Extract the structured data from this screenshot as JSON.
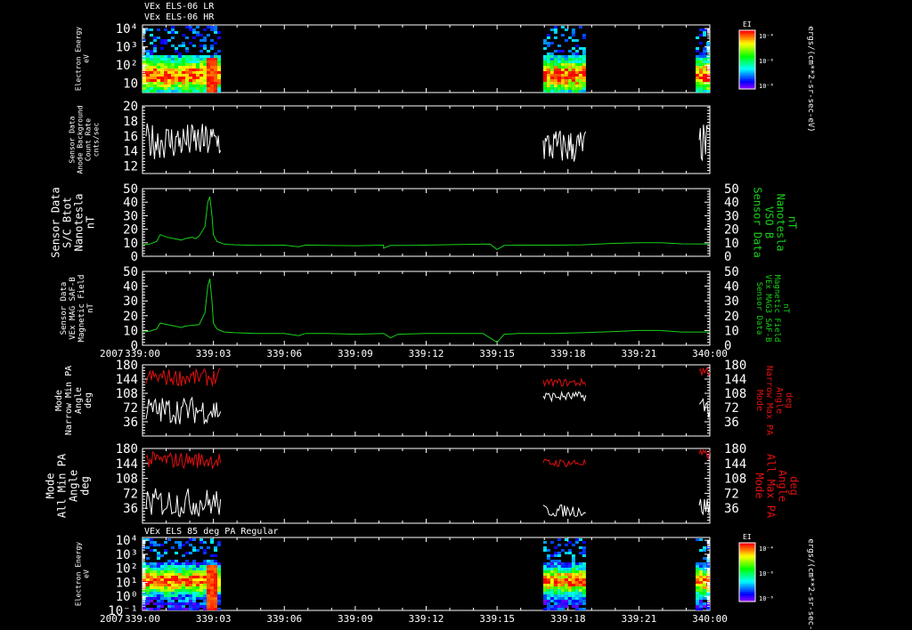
{
  "header": {
    "line1": "VEx ELS-06 LR",
    "line2": "VEx ELS-06 HR",
    "bottom_title": "VEx ELS 85 deg PA Regular",
    "year_label": "2007"
  },
  "colorbar": {
    "label": "EI",
    "ticks": [
      "10⁻⁴",
      "10⁻⁶",
      "10⁻⁸"
    ],
    "unit_label": "ergs/(cm**2-sr-sec-eV)"
  },
  "time_axis": {
    "ticks": [
      "339:00",
      "339:03",
      "339:06",
      "339:09",
      "339:12",
      "339:15",
      "339:18",
      "339:21",
      "340:00"
    ]
  },
  "colors": {
    "green": "#18d018",
    "red": "#e01010",
    "white": "#ffffff"
  },
  "chart_data": [
    {
      "type": "heatmap",
      "name": "electron-energy-top",
      "ylabel": [
        "Electron Energy",
        "eV"
      ],
      "yticks": [
        "10⁴",
        "10³",
        "10²",
        "10"
      ],
      "ylog": true,
      "ylim_exp": [
        0.5,
        4.2
      ],
      "data_intervals_hr": [
        [
          0.0,
          1.1
        ],
        [
          5.65,
          6.25
        ],
        [
          7.8,
          8.0
        ]
      ]
    },
    {
      "type": "line",
      "name": "anode-background",
      "ylabel": [
        "Sensor Data",
        "Anode Background",
        "Count Rate",
        "cnts/sec"
      ],
      "ylim": [
        11,
        20
      ],
      "yticks": [
        12,
        14,
        16,
        18,
        20
      ],
      "series": [
        {
          "color": "white",
          "segments": [
            {
              "t0": 0.05,
              "t1": 1.1,
              "mean": 15.3,
              "amp": 2.4,
              "n": 70
            },
            {
              "t0": 5.65,
              "t1": 6.25,
              "mean": 14.6,
              "amp": 2.4,
              "n": 40
            },
            {
              "t0": 7.85,
              "t1": 8.0,
              "mean": 15.0,
              "amp": 2.6,
              "n": 10
            }
          ]
        }
      ]
    },
    {
      "type": "line",
      "name": "btot",
      "ylabel": [
        "Sensor Data",
        "S/C Btot",
        "Nanotesla",
        "nT"
      ],
      "ylabel_right": [
        "Sensor Data",
        "VSO B",
        "Nanotesla",
        "nT"
      ],
      "ylim": [
        0,
        50
      ],
      "yticks": [
        0,
        10,
        20,
        30,
        40,
        50
      ],
      "series": [
        {
          "color": "green",
          "points": [
            [
              0.0,
              8.5
            ],
            [
              0.1,
              9
            ],
            [
              0.2,
              11
            ],
            [
              0.25,
              16
            ],
            [
              0.35,
              14
            ],
            [
              0.45,
              13
            ],
            [
              0.55,
              12
            ],
            [
              0.6,
              13
            ],
            [
              0.7,
              14
            ],
            [
              0.75,
              13
            ],
            [
              0.8,
              15
            ],
            [
              0.88,
              22
            ],
            [
              0.92,
              40
            ],
            [
              0.95,
              44
            ],
            [
              0.98,
              30
            ],
            [
              1.0,
              16
            ],
            [
              1.05,
              11
            ],
            [
              1.15,
              9
            ],
            [
              1.3,
              8.5
            ],
            [
              1.6,
              8
            ],
            [
              2.0,
              8.2
            ],
            [
              2.2,
              7
            ],
            [
              2.3,
              8.3
            ],
            [
              2.6,
              8
            ],
            [
              3.0,
              7.8
            ],
            [
              3.4,
              8.2
            ],
            [
              3.4,
              6
            ],
            [
              3.5,
              8
            ],
            [
              3.8,
              8
            ],
            [
              4.2,
              8.5
            ],
            [
              4.9,
              9
            ],
            [
              5.0,
              5
            ],
            [
              5.1,
              8
            ],
            [
              5.3,
              8.2
            ],
            [
              5.8,
              8.2
            ],
            [
              6.2,
              8.5
            ],
            [
              6.6,
              9.5
            ],
            [
              7.0,
              10
            ],
            [
              7.3,
              10
            ],
            [
              7.6,
              9.2
            ],
            [
              8.0,
              9
            ]
          ]
        }
      ]
    },
    {
      "type": "line",
      "name": "saf-b",
      "ylabel": [
        "Sensor Data",
        "VEx MAG SAF-B",
        "Magnetic Field",
        "nT"
      ],
      "ylabel_right": [
        "Sensor Data",
        "VEx MAG3 SAF-B",
        "Magnetic Field",
        "nT"
      ],
      "ylim": [
        0,
        50
      ],
      "yticks": [
        0,
        10,
        20,
        30,
        40,
        50
      ],
      "series": [
        {
          "color": "green",
          "points": [
            [
              0.0,
              9
            ],
            [
              0.1,
              9.5
            ],
            [
              0.2,
              11
            ],
            [
              0.25,
              15
            ],
            [
              0.35,
              14
            ],
            [
              0.45,
              13
            ],
            [
              0.55,
              12
            ],
            [
              0.6,
              13
            ],
            [
              0.7,
              13.5
            ],
            [
              0.8,
              14
            ],
            [
              0.88,
              22
            ],
            [
              0.92,
              40
            ],
            [
              0.95,
              45
            ],
            [
              0.98,
              30
            ],
            [
              1.0,
              15
            ],
            [
              1.05,
              11
            ],
            [
              1.15,
              9
            ],
            [
              1.3,
              8.5
            ],
            [
              1.6,
              8
            ],
            [
              2.0,
              8
            ],
            [
              2.2,
              6.5
            ],
            [
              2.3,
              8
            ],
            [
              2.6,
              8
            ],
            [
              3.0,
              7.5
            ],
            [
              3.4,
              8
            ],
            [
              3.5,
              5
            ],
            [
              3.6,
              7.5
            ],
            [
              4.0,
              8
            ],
            [
              4.4,
              8
            ],
            [
              4.8,
              8
            ],
            [
              5.0,
              2
            ],
            [
              5.1,
              7.5
            ],
            [
              5.3,
              8
            ],
            [
              5.8,
              8
            ],
            [
              6.2,
              8.5
            ],
            [
              6.6,
              9.2
            ],
            [
              7.0,
              10
            ],
            [
              7.3,
              10
            ],
            [
              7.6,
              9
            ],
            [
              8.0,
              9
            ]
          ]
        }
      ]
    },
    {
      "type": "line",
      "name": "narrow-pa",
      "ylabel": [
        "Mode",
        "Narrow Min PA",
        "Angle",
        "deg"
      ],
      "ylabel_right": [
        "Mode",
        "Narrow Max PA",
        "Angle",
        "deg"
      ],
      "ylim": [
        0,
        180
      ],
      "yticks": [
        36,
        72,
        108,
        144,
        180
      ],
      "series": [
        {
          "color": "red",
          "segments": [
            {
              "t0": 0.05,
              "t1": 1.1,
              "mean": 148,
              "amp": 22,
              "n": 55
            },
            {
              "t0": 5.65,
              "t1": 6.25,
              "mean": 135,
              "amp": 10,
              "n": 30
            },
            {
              "t0": 7.85,
              "t1": 8.0,
              "mean": 165,
              "amp": 15,
              "n": 8
            }
          ]
        },
        {
          "color": "white",
          "segments": [
            {
              "t0": 0.05,
              "t1": 1.1,
              "mean": 65,
              "amp": 35,
              "n": 55
            },
            {
              "t0": 5.65,
              "t1": 6.25,
              "mean": 100,
              "amp": 12,
              "n": 30
            },
            {
              "t0": 7.85,
              "t1": 8.0,
              "mean": 75,
              "amp": 30,
              "n": 8
            }
          ]
        }
      ]
    },
    {
      "type": "line",
      "name": "all-pa",
      "ylabel": [
        "Mode",
        "All Min PA",
        "Angle",
        "deg"
      ],
      "ylabel_right": [
        "Mode",
        "All Max PA",
        "Angle",
        "deg"
      ],
      "ylim": [
        0,
        180
      ],
      "yticks": [
        36,
        72,
        108,
        144,
        180
      ],
      "series": [
        {
          "color": "red",
          "segments": [
            {
              "t0": 0.05,
              "t1": 1.1,
              "mean": 152,
              "amp": 20,
              "n": 55
            },
            {
              "t0": 5.65,
              "t1": 6.25,
              "mean": 145,
              "amp": 10,
              "n": 30
            },
            {
              "t0": 7.85,
              "t1": 8.0,
              "mean": 165,
              "amp": 12,
              "n": 8
            }
          ]
        },
        {
          "color": "white",
          "segments": [
            {
              "t0": 0.05,
              "t1": 1.1,
              "mean": 50,
              "amp": 35,
              "n": 55
            },
            {
              "t0": 5.65,
              "t1": 6.25,
              "mean": 30,
              "amp": 15,
              "n": 30
            },
            {
              "t0": 7.85,
              "t1": 8.0,
              "mean": 40,
              "amp": 25,
              "n": 8
            }
          ]
        }
      ]
    },
    {
      "type": "heatmap",
      "name": "electron-energy-85pa",
      "ylabel": [
        "Electron Energy",
        "eV"
      ],
      "yticks": [
        "10⁴",
        "10³",
        "10²",
        "10¹",
        "10⁰",
        "10⁻¹"
      ],
      "ylog": true,
      "ylim_exp": [
        -1,
        4.2
      ],
      "data_intervals_hr": [
        [
          0.0,
          1.1
        ],
        [
          5.65,
          6.25
        ],
        [
          7.8,
          8.0
        ]
      ]
    }
  ]
}
